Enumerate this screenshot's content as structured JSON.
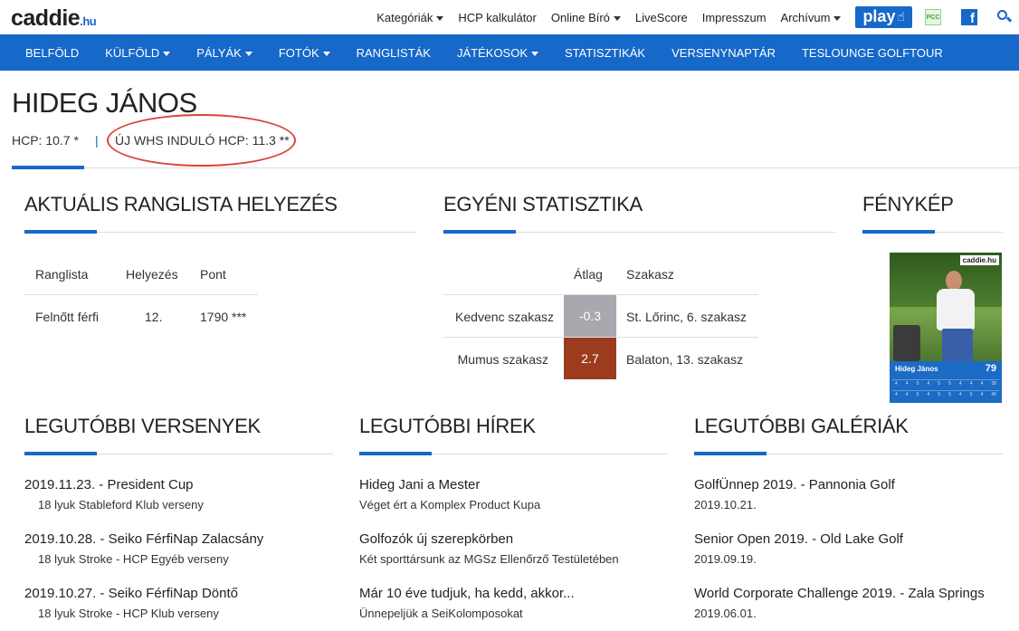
{
  "logo": {
    "main": "caddie",
    "suffix": ".hu"
  },
  "toplinks": [
    {
      "label": "Kategóriák",
      "dropdown": true
    },
    {
      "label": "HCP kalkulátor",
      "dropdown": false
    },
    {
      "label": "Online Bíró",
      "dropdown": true
    },
    {
      "label": "LiveScore",
      "dropdown": false
    },
    {
      "label": "Impresszum",
      "dropdown": false
    },
    {
      "label": "Archívum",
      "dropdown": true
    }
  ],
  "play_label": "play",
  "pcc_label": "PCC",
  "facebook_glyph": "f",
  "mainnav": [
    {
      "label": "BELFÖLD",
      "dropdown": false
    },
    {
      "label": "KÜLFÖLD",
      "dropdown": true
    },
    {
      "label": "PÁLYÁK",
      "dropdown": true
    },
    {
      "label": "FOTÓK",
      "dropdown": true
    },
    {
      "label": "RANGLISTÁK",
      "dropdown": false
    },
    {
      "label": "JÁTÉKOSOK",
      "dropdown": true
    },
    {
      "label": "STATISZTIKÁK",
      "dropdown": false
    },
    {
      "label": "VERSENYNAPTÁR",
      "dropdown": false
    },
    {
      "label": "TESLOUNGE GOLFTOUR",
      "dropdown": false
    }
  ],
  "profile": {
    "name": "HIDEG JÁNOS",
    "hcp": "HCP: 10.7 *",
    "separator": "|",
    "whs": "ÚJ WHS INDULÓ HCP: 11.3 **"
  },
  "ranking": {
    "heading": "AKTUÁLIS RANGLISTA HELYEZÉS",
    "headers": [
      "Ranglista",
      "Helyezés",
      "Pont"
    ],
    "row": [
      "Felnőtt férfi",
      "12.",
      "1790 ***"
    ]
  },
  "stats": {
    "heading": "EGYÉNI STATISZTIKA",
    "headers": [
      "Átlag",
      "Szakasz"
    ],
    "rows": [
      {
        "label": "Kedvenc szakasz",
        "value": "-0.3",
        "segment": "St. Lőrinc, 6. szakasz",
        "color": "#a7a9ae"
      },
      {
        "label": "Mumus szakasz",
        "value": "2.7",
        "segment": "Balaton, 13. szakasz",
        "color": "#9c3b1e"
      }
    ]
  },
  "photo": {
    "heading": "FÉNYKÉP",
    "logo": "caddie.hu",
    "card_name": "Hideg János",
    "card_score": "79",
    "row1_total": "39",
    "row2_total": "40"
  },
  "competitions": {
    "heading": "LEGUTÓBBI VERSENYEK",
    "items": [
      {
        "title": "2019.11.23. - President Cup",
        "sub": "18 lyuk Stableford Klub verseny"
      },
      {
        "title": "2019.10.28. - Seiko FérfiNap Zalacsány",
        "sub": "18 lyuk Stroke - HCP Egyéb verseny"
      },
      {
        "title": "2019.10.27. - Seiko FérfiNap Döntő",
        "sub": "18 lyuk Stroke - HCP Klub verseny"
      }
    ]
  },
  "news": {
    "heading": "LEGUTÓBBI HÍREK",
    "items": [
      {
        "title": "Hideg Jani a Mester",
        "sub": "Véget ért a Komplex Product Kupa"
      },
      {
        "title": "Golfozók új szerepkörben",
        "sub": "Két sporttársunk az MGSz Ellenőrző Testületében"
      },
      {
        "title": "Már 10 éve tudjuk, ha kedd, akkor...",
        "sub": "Ünnepeljük a SeiKolomposokat"
      }
    ]
  },
  "galleries": {
    "heading": "LEGUTÓBBI GALÉRIÁK",
    "items": [
      {
        "title": "GolfÜnnep 2019. - Pannonia Golf",
        "sub": "2019.10.21."
      },
      {
        "title": "Senior Open 2019. - Old Lake Golf",
        "sub": "2019.09.19."
      },
      {
        "title": "World Corporate Challenge 2019. - Zala Springs",
        "sub": "2019.06.01."
      }
    ]
  }
}
